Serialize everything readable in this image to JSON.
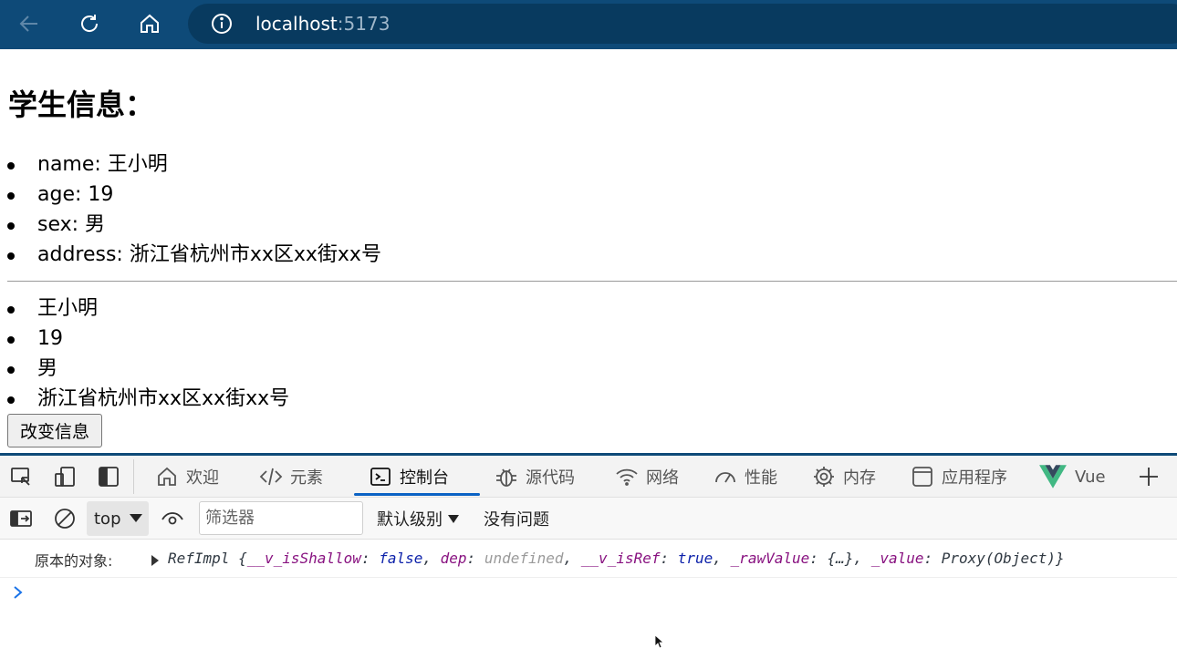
{
  "browser": {
    "url_host": "localhost",
    "url_port": ":5173"
  },
  "page": {
    "heading": "学生信息：",
    "student_fields": [
      "name: 王小明",
      "age: 19",
      "sex: 男",
      "address: 浙江省杭州市xx区xx街xx号"
    ],
    "student_values": [
      "王小明",
      "19",
      "男",
      "浙江省杭州市xx区xx街xx号"
    ],
    "change_button": "改变信息"
  },
  "devtools": {
    "tabs": [
      {
        "label": "欢迎",
        "icon": "home-icon"
      },
      {
        "label": "元素",
        "icon": "code-icon"
      },
      {
        "label": "控制台",
        "icon": "console-icon",
        "active": true
      },
      {
        "label": "源代码",
        "icon": "bug-icon"
      },
      {
        "label": "网络",
        "icon": "wifi-icon"
      },
      {
        "label": "性能",
        "icon": "gauge-icon"
      },
      {
        "label": "内存",
        "icon": "chip-icon"
      },
      {
        "label": "应用程序",
        "icon": "app-window-icon"
      },
      {
        "label": "Vue",
        "icon": "vue-logo-icon"
      }
    ],
    "toolbar": {
      "context": "top",
      "filter_placeholder": "筛选器",
      "level": "默认级别",
      "issues": "没有问题"
    },
    "console": {
      "label": "原本的对象:",
      "object_name": "RefImpl",
      "props": [
        {
          "key": "__v_isShallow",
          "value": "false",
          "kind": "bool"
        },
        {
          "key": "dep",
          "value": "undefined",
          "kind": "undef"
        },
        {
          "key": "__v_isRef",
          "value": "true",
          "kind": "bool"
        },
        {
          "key": "_rawValue",
          "value": "{…}",
          "kind": "plain"
        },
        {
          "key": "_value",
          "value": "Proxy(Object)",
          "kind": "plain"
        }
      ]
    }
  },
  "colors": {
    "chrome_bg": "#0e4a78",
    "address_bg": "#083a5f",
    "active_tab_accent": "#0b62c4",
    "vue_green": "#41b883",
    "vue_dark": "#35495e"
  }
}
